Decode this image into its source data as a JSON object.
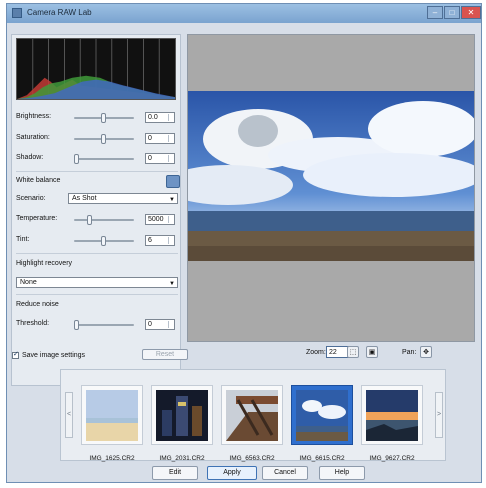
{
  "window": {
    "title": "Camera RAW Lab",
    "controls": {
      "minimize": "–",
      "maximize": "□",
      "close": "✕"
    }
  },
  "left_panel": {
    "adjustments": [
      {
        "label": "Brightness:",
        "value": "0.0",
        "level": 0.5
      },
      {
        "label": "Saturation:",
        "value": "0",
        "level": 0.5
      },
      {
        "label": "Shadow:",
        "value": "0",
        "level": 0.0
      }
    ],
    "white_balance": {
      "title": "White balance",
      "scenario_label": "Scenario:",
      "scenario_value": "As Shot",
      "temperature_label": "Temperature:",
      "temperature_value": "5000",
      "temperature_level": 0.25,
      "tint_label": "Tint:",
      "tint_value": "6",
      "tint_level": 0.5
    },
    "highlight_recovery": {
      "title": "Highlight recovery",
      "value": "None"
    },
    "reduce_noise": {
      "title": "Reduce noise",
      "threshold_label": "Threshold:",
      "threshold_value": "0",
      "threshold_level": 0.0
    },
    "save_settings_label": "Save image settings",
    "reset_label": "Reset"
  },
  "preview_controls": {
    "zoom_label": "Zoom:",
    "zoom_value": "22",
    "pan_label": "Pan:"
  },
  "filmstrip": {
    "prev": "<",
    "next": ">",
    "items": [
      {
        "filename": "IMG_1625.CR2"
      },
      {
        "filename": "IMG_2031.CR2"
      },
      {
        "filename": "IMG_6563.CR2"
      },
      {
        "filename": "IMG_6615.CR2"
      },
      {
        "filename": "IMG_9627.CR2"
      }
    ],
    "selected_index": 3
  },
  "buttons": {
    "edit": "Edit",
    "apply": "Apply",
    "cancel": "Cancel",
    "help": "Help"
  },
  "colors": {
    "accent": "#2f6fce",
    "histogram_red": "#c23b35",
    "histogram_green": "#3f9a3a",
    "histogram_blue": "#4267c8"
  }
}
